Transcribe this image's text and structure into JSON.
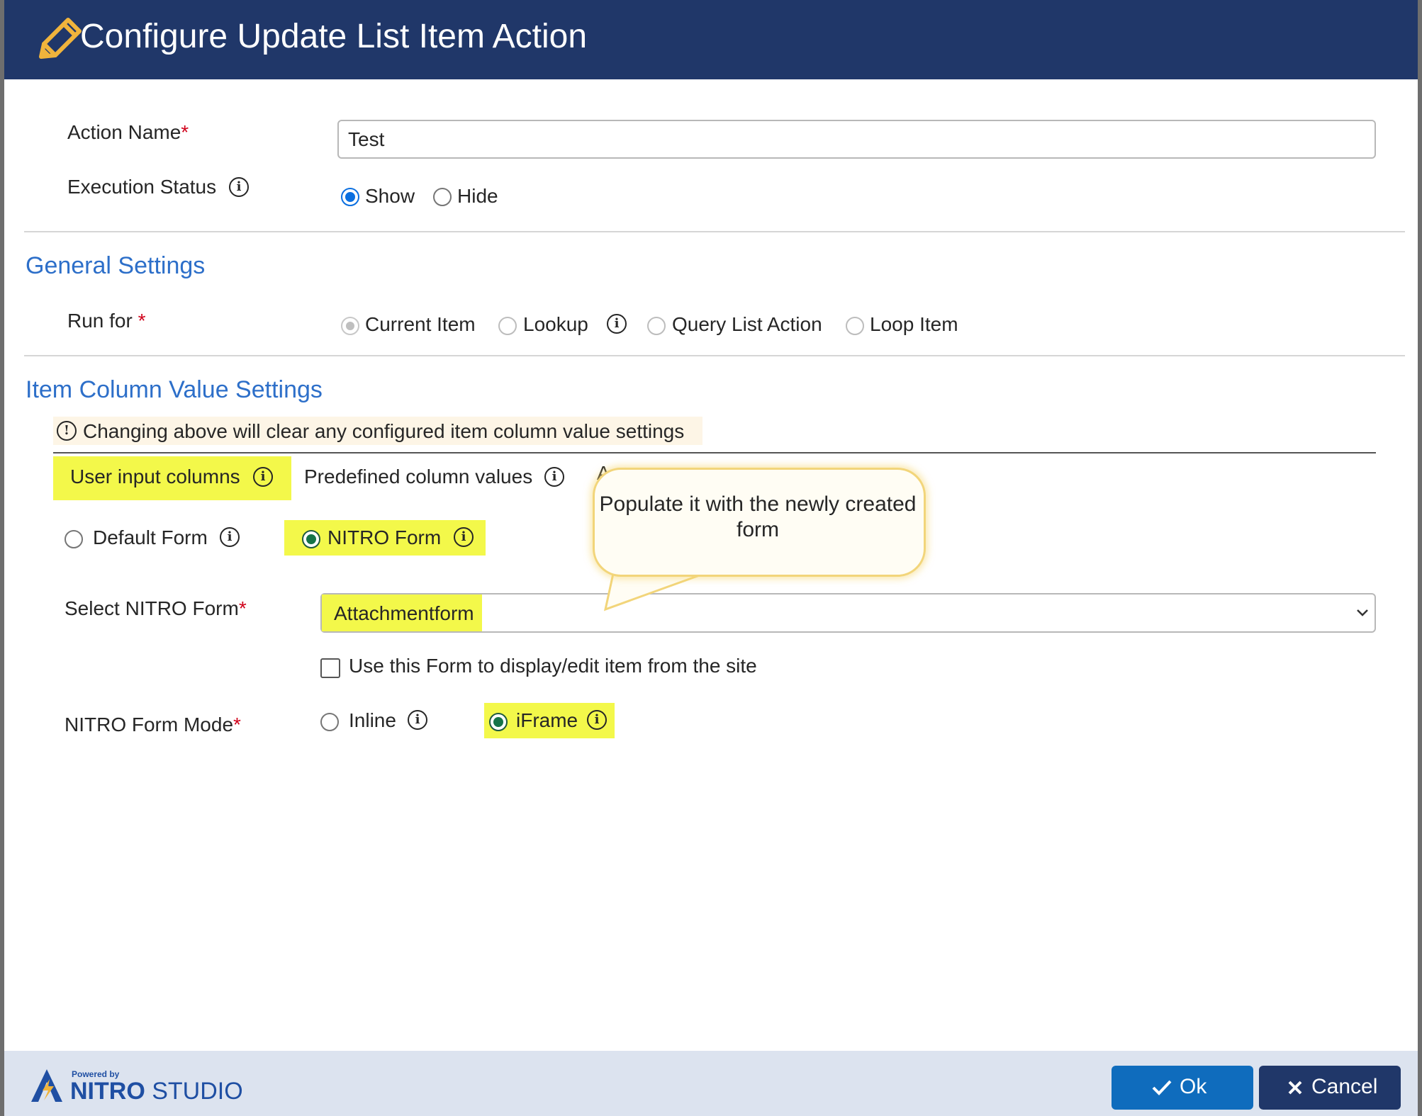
{
  "dialog": {
    "title": "Configure Update List Item Action",
    "title_icon": "pencil-icon",
    "colors": {
      "header": "#203769",
      "accent": "#0f6cbd",
      "section_heading": "#2d6fc9",
      "highlight": "#f3f84a"
    }
  },
  "action_name": {
    "label": "Action Name",
    "required_mark": "*",
    "value": "Test"
  },
  "execution_status": {
    "label": "Execution Status",
    "options": [
      {
        "label": "Show",
        "selected": true
      },
      {
        "label": "Hide",
        "selected": false
      }
    ]
  },
  "general_settings": {
    "heading": "General Settings",
    "run_for": {
      "label": "Run for",
      "required_mark": "*",
      "options": [
        {
          "label": "Current Item",
          "selected": true
        },
        {
          "label": "Lookup",
          "selected": false
        },
        {
          "label": "Query List Action",
          "selected": false
        },
        {
          "label": "Loop Item",
          "selected": false
        }
      ]
    }
  },
  "item_column_settings": {
    "heading": "Item Column Value Settings",
    "warning": "Changing above will clear any configured item column value settings",
    "tabs": [
      {
        "label": "User input columns",
        "active": true
      },
      {
        "label": "Predefined column values",
        "active": false
      },
      {
        "label": "A",
        "active": false
      }
    ],
    "form_type": {
      "options": [
        {
          "label": "Default Form",
          "selected": false
        },
        {
          "label": "NITRO Form",
          "selected": true
        }
      ]
    },
    "select_form": {
      "label": "Select NITRO Form",
      "required_mark": "*",
      "value": "Attachmentform"
    },
    "use_form_checkbox": {
      "label": "Use this Form to display/edit item from the site",
      "checked": false
    },
    "form_mode": {
      "label": "NITRO Form Mode",
      "required_mark": "*",
      "options": [
        {
          "label": "Inline",
          "selected": false
        },
        {
          "label": "iFrame",
          "selected": true
        }
      ]
    }
  },
  "callout": {
    "text": "Populate it with the newly created form"
  },
  "footer": {
    "brand_small": "Powered by",
    "brand_bold": "NITRO",
    "brand_light": "STUDIO",
    "ok_label": "Ok",
    "cancel_label": "Cancel"
  }
}
